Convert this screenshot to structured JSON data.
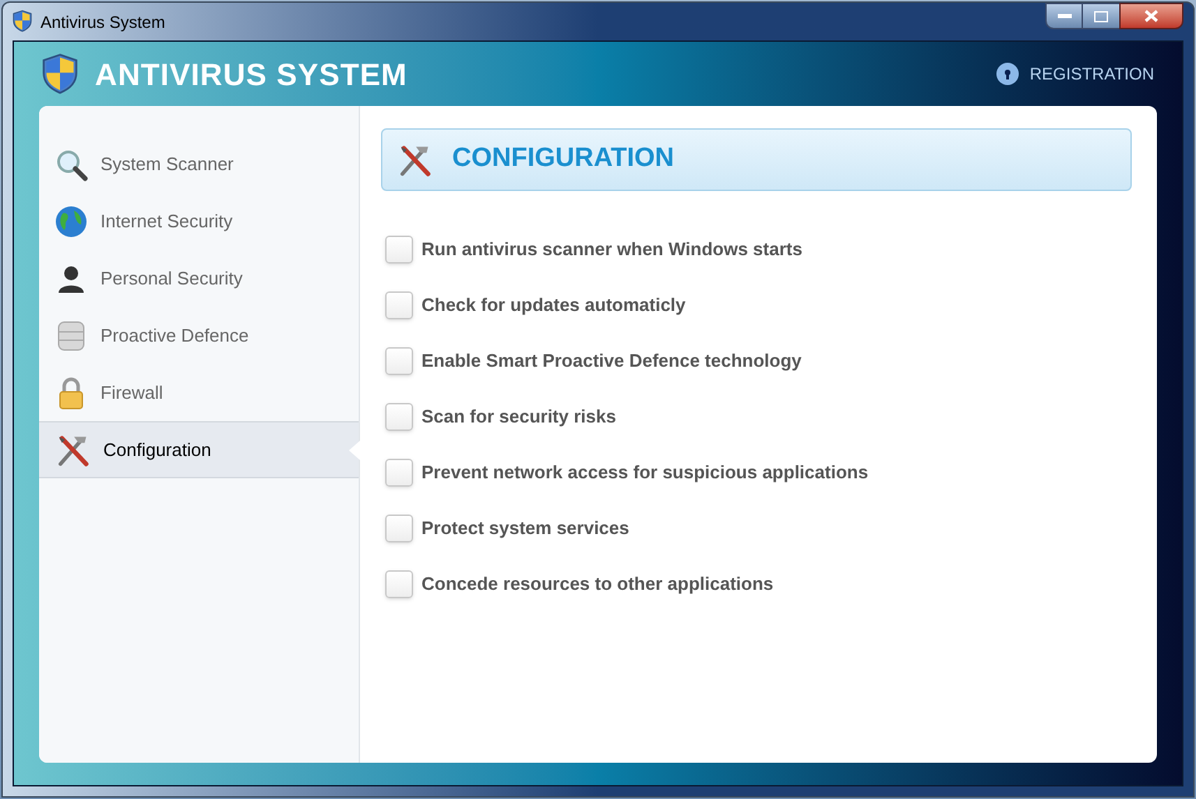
{
  "window": {
    "title": "Antivirus System"
  },
  "header": {
    "app_name": "ANTIVIRUS SYSTEM",
    "registration": "REGISTRATION"
  },
  "sidebar": {
    "items": [
      {
        "label": "System Scanner",
        "selected": false
      },
      {
        "label": "Internet Security",
        "selected": false
      },
      {
        "label": "Personal Security",
        "selected": false
      },
      {
        "label": "Proactive Defence",
        "selected": false
      },
      {
        "label": "Firewall",
        "selected": false
      },
      {
        "label": "Configuration",
        "selected": true
      }
    ]
  },
  "panel": {
    "title": "CONFIGURATION",
    "options": [
      {
        "label": "Run antivirus scanner when Windows starts",
        "checked": false
      },
      {
        "label": "Check for updates automaticly",
        "checked": false
      },
      {
        "label": "Enable Smart Proactive Defence technology",
        "checked": false
      },
      {
        "label": "Scan for security risks",
        "checked": false
      },
      {
        "label": "Prevent network access for suspicious applications",
        "checked": false
      },
      {
        "label": "Protect system services",
        "checked": false
      },
      {
        "label": "Concede resources to other applications",
        "checked": false
      }
    ]
  }
}
